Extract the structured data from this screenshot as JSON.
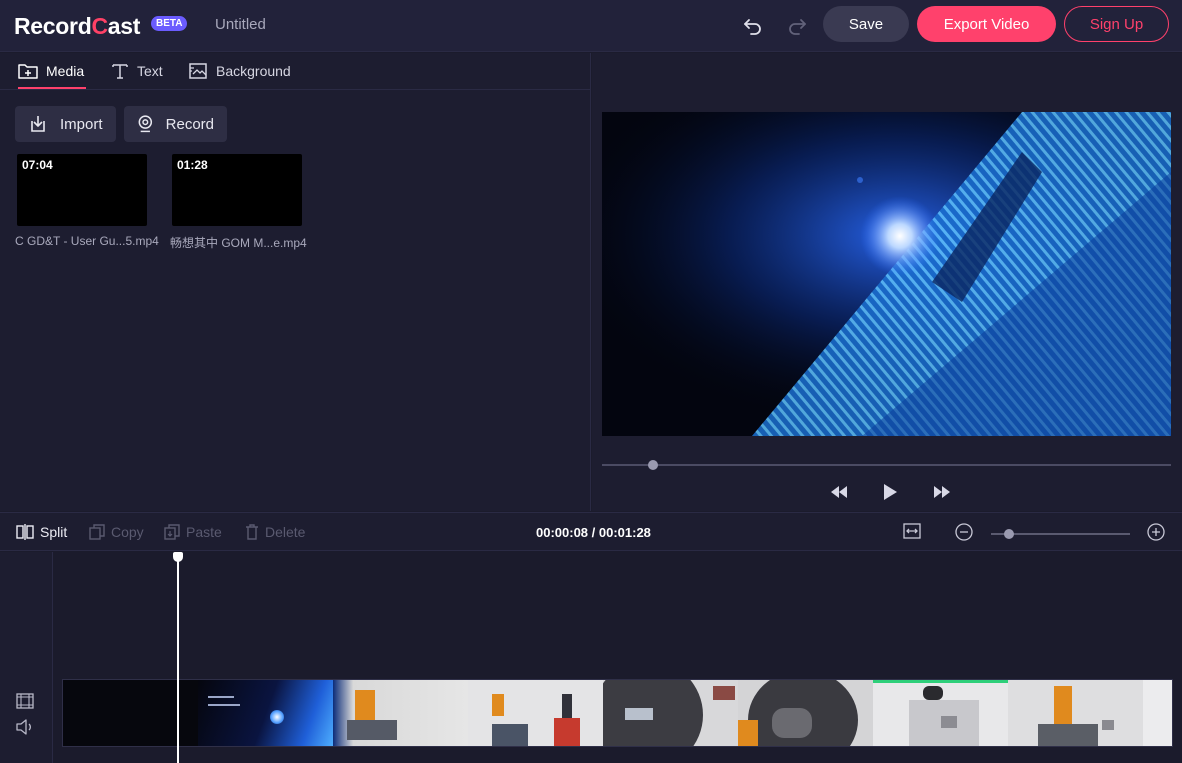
{
  "app": {
    "logo_prefix": "Record",
    "logo_c": "C",
    "logo_suffix": "ast",
    "badge": "BETA",
    "document_title": "Untitled"
  },
  "header": {
    "undo_icon": "undo-icon",
    "redo_icon": "redo-icon",
    "save_label": "Save",
    "export_label": "Export Video",
    "signup_label": "Sign Up"
  },
  "tabs": [
    {
      "label": "Media",
      "icon": "folder-plus-icon",
      "active": true
    },
    {
      "label": "Text",
      "icon": "text-icon",
      "active": false
    },
    {
      "label": "Background",
      "icon": "background-icon",
      "active": false
    }
  ],
  "media_tools": {
    "import_label": "Import",
    "record_label": "Record"
  },
  "media_items": [
    {
      "duration": "07:04",
      "name": "C GD&T - User Gu...5.mp4"
    },
    {
      "duration": "01:28",
      "name": "畅想其中 GOM M...e.mp4"
    }
  ],
  "player": {
    "progress_fraction": 0.09,
    "rewind_icon": "rewind-icon",
    "play_icon": "play-icon",
    "forward_icon": "fast-forward-icon"
  },
  "timeline_toolbar": {
    "split_label": "Split",
    "copy_label": "Copy",
    "paste_label": "Paste",
    "delete_label": "Delete",
    "timecode": "00:00:08 / 00:01:28",
    "zoom_fraction": 0.13
  },
  "colors": {
    "accent": "#ff416c",
    "beta_badge": "#6b5cff",
    "background": "#1b1b2c"
  }
}
